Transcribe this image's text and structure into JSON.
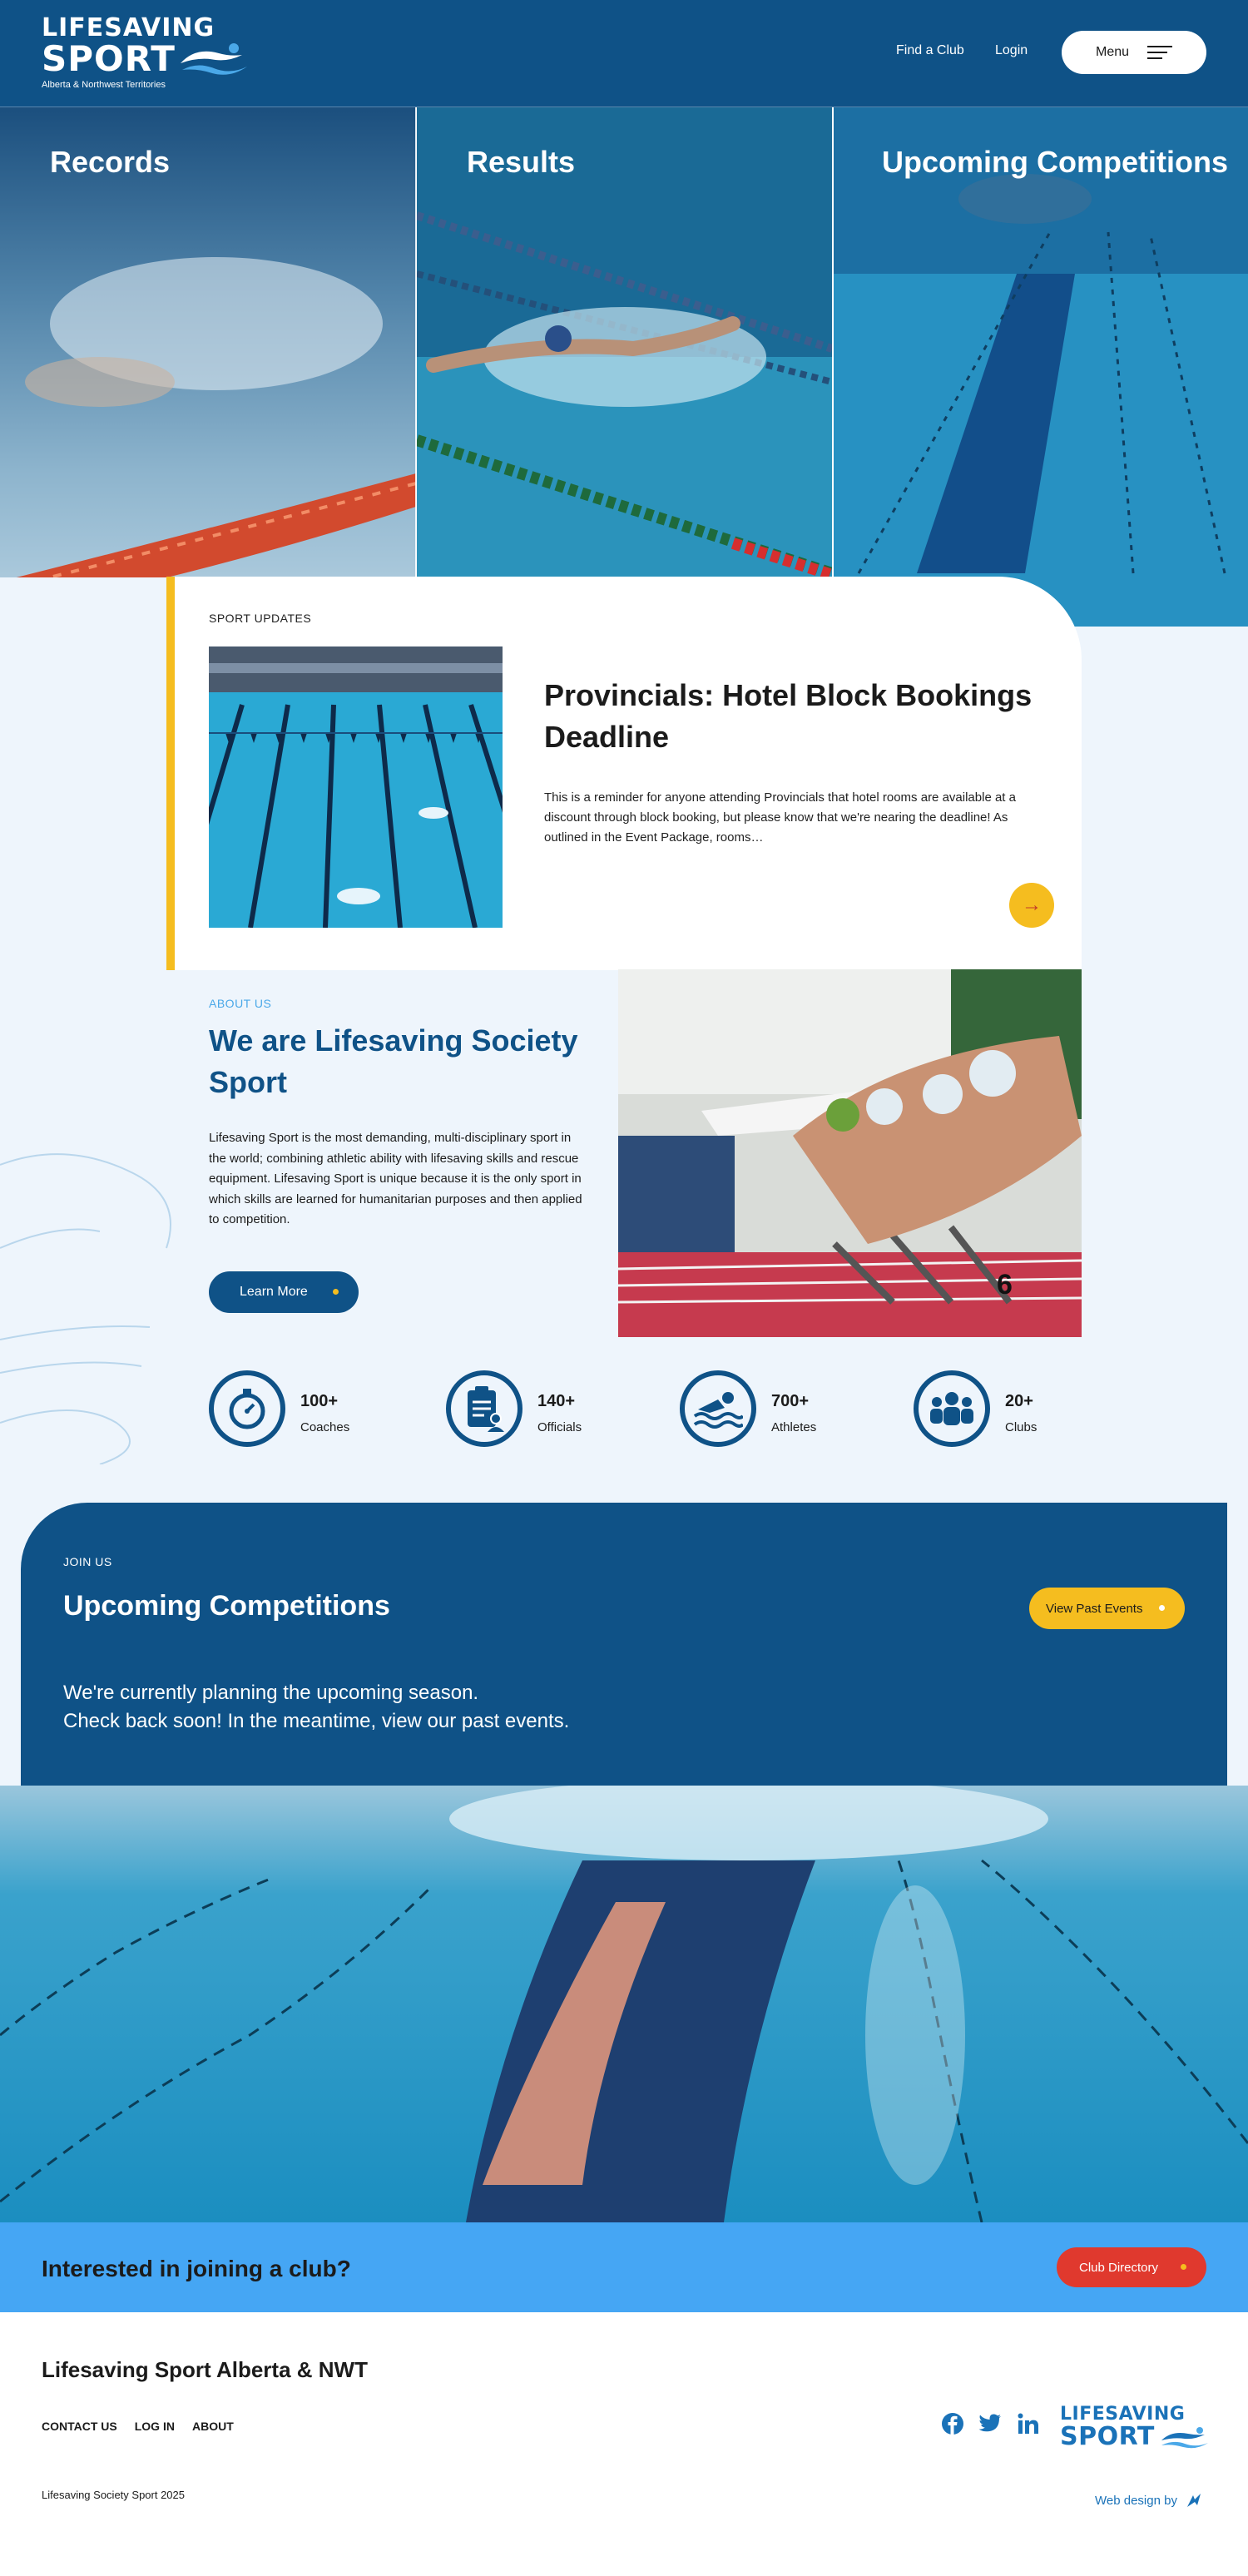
{
  "header": {
    "logo": {
      "line1": "LIFESAVING",
      "line2": "SPORT",
      "line3": "Alberta & Northwest Territories"
    },
    "nav": {
      "find_club": "Find a Club",
      "login": "Login",
      "menu": "Menu"
    }
  },
  "hero": {
    "panels": [
      {
        "title": "Records"
      },
      {
        "title": "Results"
      },
      {
        "title": "Upcoming Competitions"
      }
    ]
  },
  "news": {
    "eyebrow": "SPORT UPDATES",
    "title": "Provincials: Hotel Block Bookings Deadline",
    "excerpt": "This is a reminder for anyone attending Provincials that hotel rooms are available at a discount through block booking, but please know that we're nearing the deadline! As outlined in the Event Package, rooms…",
    "arrow": "→"
  },
  "about": {
    "eyebrow": "ABOUT US",
    "title": "We are Lifesaving Society Sport",
    "body": "Lifesaving Sport is the most demanding, multi-disciplinary sport in the world; combining athletic ability with lifesaving skills and rescue equipment. Lifesaving Sport is unique because it is the only sport in which skills are learned for humanitarian purposes and then applied to competition.",
    "button": "Learn More"
  },
  "stats": [
    {
      "value": "100+",
      "label": "Coaches",
      "icon": "stopwatch-icon"
    },
    {
      "value": "140+",
      "label": "Officials",
      "icon": "clipboard-person-icon"
    },
    {
      "value": "700+",
      "label": "Athletes",
      "icon": "swimmer-icon"
    },
    {
      "value": "20+",
      "label": "Clubs",
      "icon": "group-icon"
    }
  ],
  "join": {
    "eyebrow": "JOIN US",
    "title": "Upcoming Competitions",
    "button": "View Past Events",
    "line1": "We're currently planning the upcoming season.",
    "line2": "Check back soon! In the meantime, view our past events."
  },
  "club_bar": {
    "text": "Interested in joining a club?",
    "button": "Club Directory"
  },
  "footer": {
    "title": "Lifesaving Sport Alberta & NWT",
    "links": [
      "CONTACT US",
      "LOG IN",
      "ABOUT"
    ],
    "social": [
      "facebook-icon",
      "twitter-icon",
      "linkedin-icon"
    ],
    "logo": {
      "line1": "LIFESAVING",
      "line2": "SPORT"
    },
    "copyright": "Lifesaving Society Sport 2025",
    "web_design": "Web design by"
  },
  "colors": {
    "brand_blue": "#0f5287",
    "accent_yellow": "#f5bd1f",
    "light_blue": "#45a6f4",
    "red": "#e0392e",
    "page_bg": "#eef5fc"
  }
}
